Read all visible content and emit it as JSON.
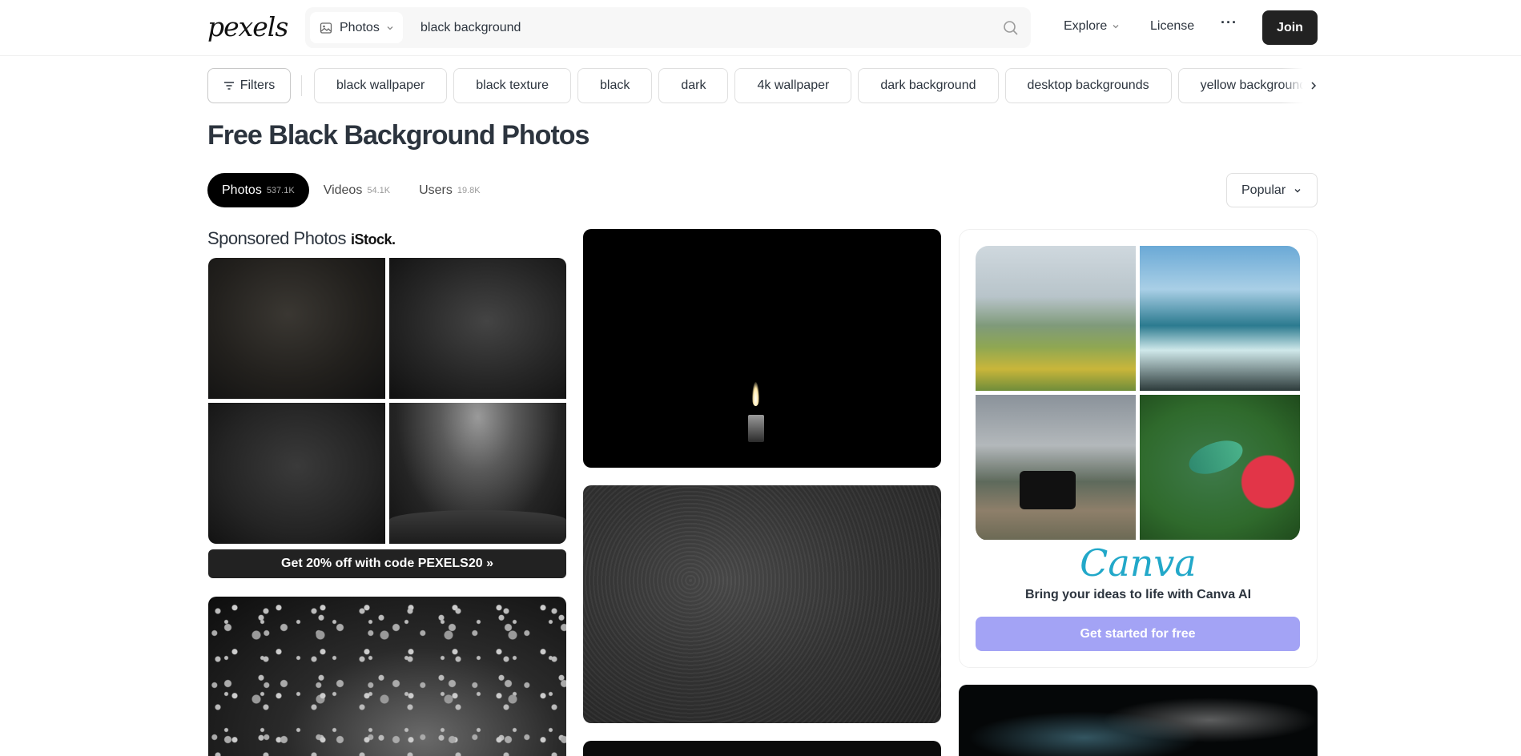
{
  "header": {
    "logo": "pexels",
    "search": {
      "type_label": "Photos",
      "value": "black background"
    },
    "nav": {
      "explore": "Explore",
      "license": "License",
      "more": "···",
      "join": "Join"
    }
  },
  "related": {
    "filters_label": "Filters",
    "tags": [
      "black wallpaper",
      "black texture",
      "black",
      "dark",
      "4k wallpaper",
      "dark background",
      "desktop backgrounds",
      "yellow background"
    ]
  },
  "page": {
    "title": "Free Black Background Photos",
    "tabs": [
      {
        "label": "Photos",
        "count": "537.1K"
      },
      {
        "label": "Videos",
        "count": "54.1K"
      },
      {
        "label": "Users",
        "count": "19.8K"
      }
    ],
    "sort": "Popular"
  },
  "sponsored": {
    "title": "Sponsored Photos",
    "brand": "iStock.",
    "promo": "Get 20% off with code PEXELS20 »"
  },
  "canva_ad": {
    "logo": "Canva",
    "tagline": "Bring your ideas to life with Canva AI",
    "cta": "Get started for free"
  },
  "icons": {
    "photo_type": "image-icon",
    "search": "search-icon",
    "chevron": "chevron-down-icon",
    "filters": "filter-icon",
    "scroll_right": "chevron-right-icon"
  }
}
